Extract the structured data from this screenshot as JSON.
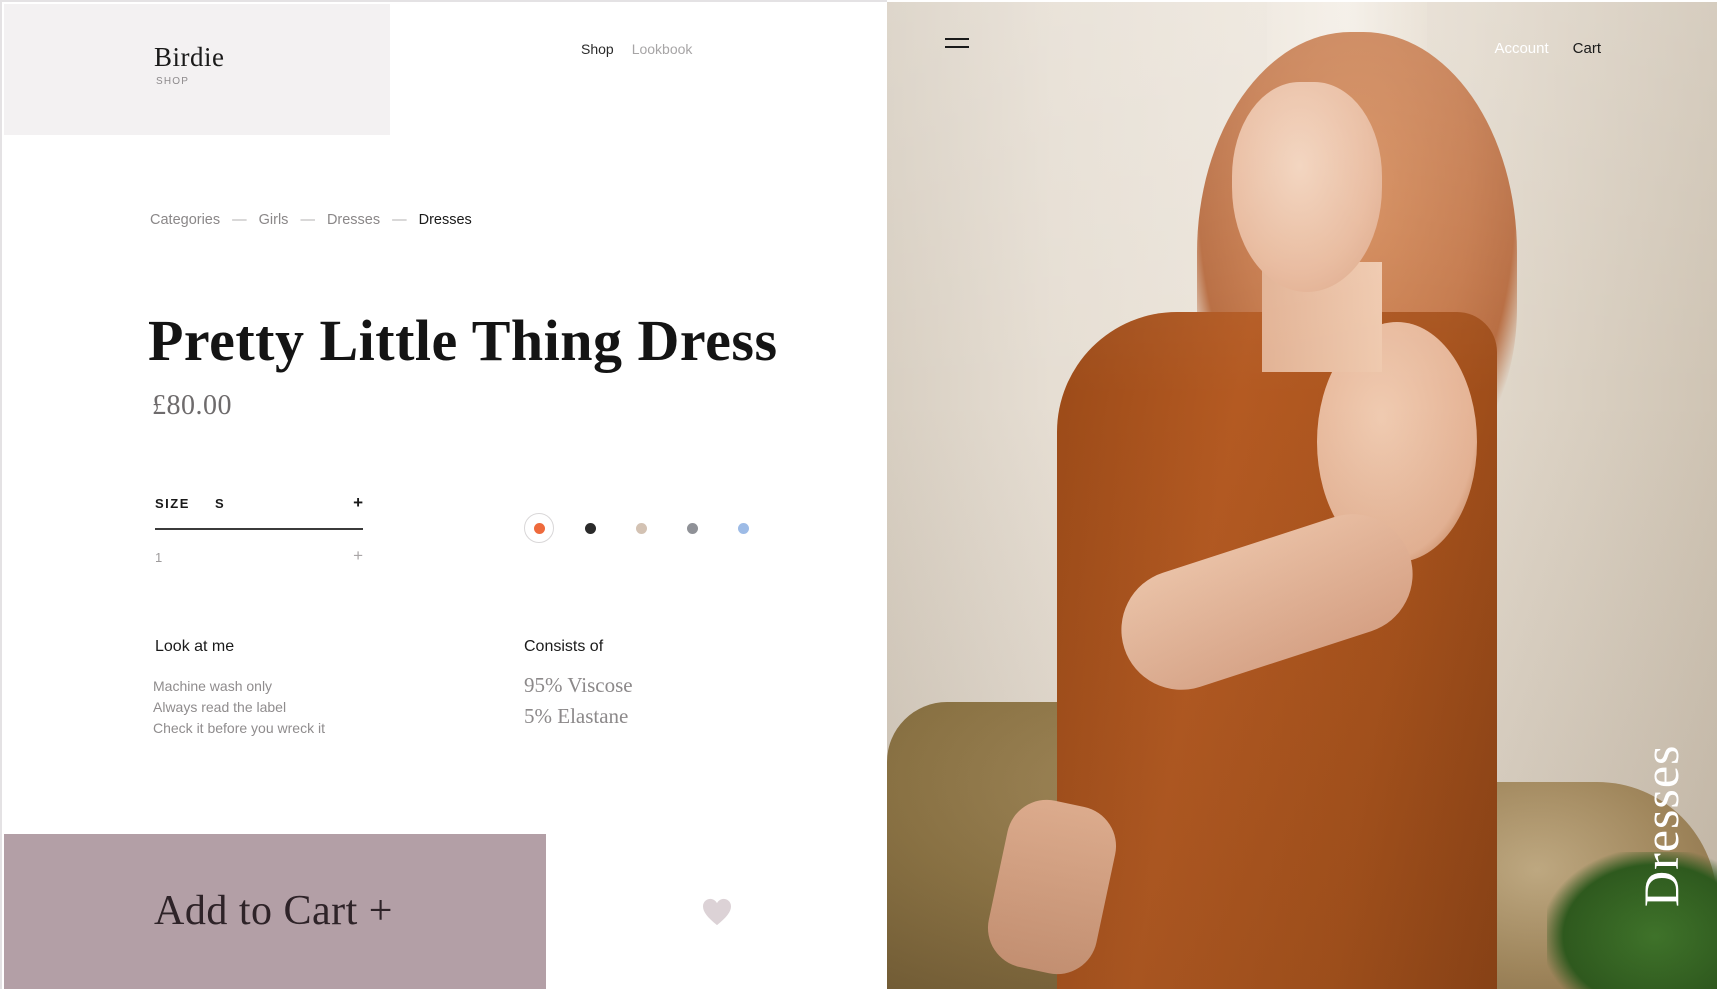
{
  "brand": {
    "name": "Birdie",
    "sub": "SHOP"
  },
  "nav": {
    "shop": "Shop",
    "lookbook": "Lookbook"
  },
  "breadcrumb": [
    "Categories",
    "Girls",
    "Dresses",
    "Dresses"
  ],
  "breadcrumb_separator": "—",
  "product": {
    "title": "Pretty Little Thing Dress",
    "price": "£80.00"
  },
  "size": {
    "label": "SIZE",
    "value": "S",
    "plus": "+"
  },
  "quantity": {
    "value": "1",
    "plus": "+"
  },
  "colors": [
    {
      "name": "orange",
      "hex": "#ee6a3c",
      "selected": true
    },
    {
      "name": "black",
      "hex": "#2a2a2a",
      "selected": false
    },
    {
      "name": "beige",
      "hex": "#d3c2b3",
      "selected": false
    },
    {
      "name": "grey",
      "hex": "#8f9197",
      "selected": false
    },
    {
      "name": "light-blue",
      "hex": "#9dbbe6",
      "selected": false
    }
  ],
  "care": {
    "title": "Look at me",
    "lines": [
      "Machine wash only",
      "Always read the label",
      "Check it before you wreck it"
    ]
  },
  "composition": {
    "title": "Consists of",
    "lines": [
      "95% Viscose",
      "5% Elastane"
    ]
  },
  "cart_button": {
    "label": "Add to Cart +",
    "color": "#b39fa6"
  },
  "favorite": {
    "icon": "heart-icon",
    "color": "#dcd2d6"
  },
  "right_nav": {
    "account": "Account",
    "cart": "Cart"
  },
  "hero_label": "Dresses"
}
